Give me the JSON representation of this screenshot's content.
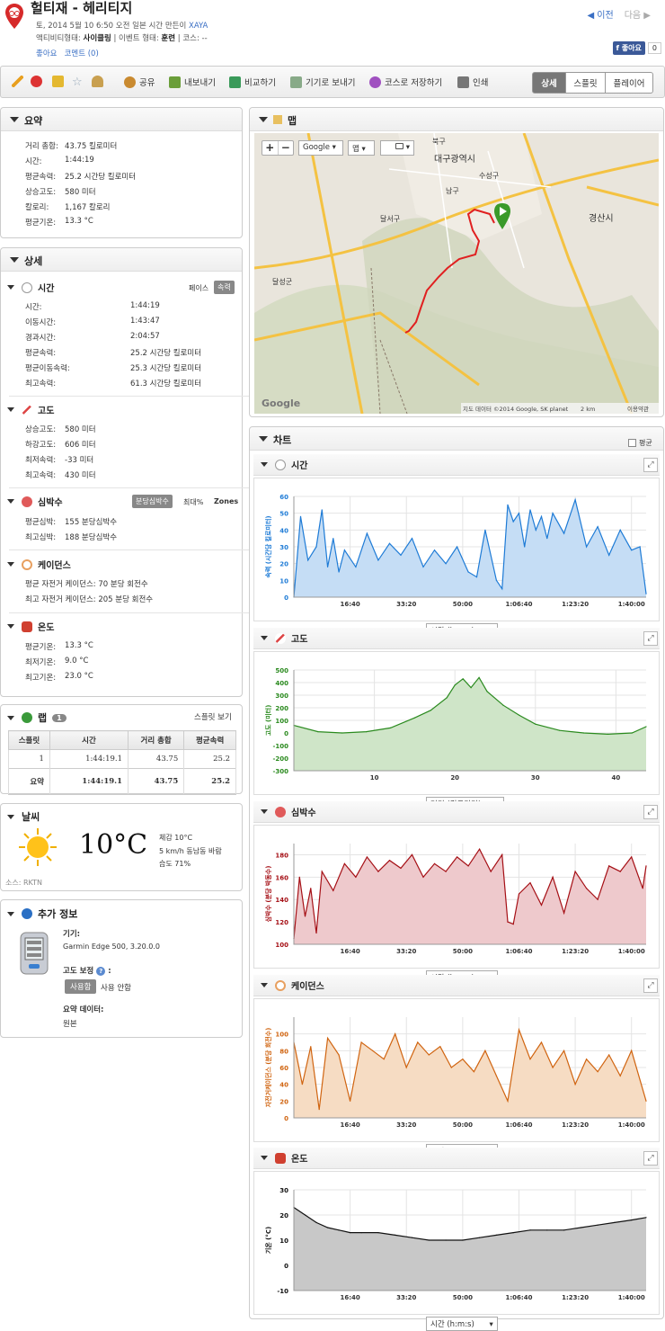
{
  "header": {
    "title": "헐티재 - 헤리티지",
    "meta_line": "토, 2014 5월 10 6:50 오전 일본 시간 만든이",
    "author": "XAYA",
    "activity_label": "액티비티형태:",
    "activity_value": "사이클링",
    "event_label": "| 이벤트 형태:",
    "event_value": "훈련",
    "course_label": "| 코스: --",
    "like": "좋아요",
    "comments": "코멘트 (0)",
    "prev": "◀ 이전",
    "next": "다음 ▶",
    "fb_like": "f 좋아요",
    "fb_count": "0"
  },
  "toolbar": {
    "share": "공유",
    "export": "내보내기",
    "compare": "비교하기",
    "send": "기기로 보내기",
    "save_course": "코스로 저장하기",
    "print": "인쇄",
    "tab_detail": "상세",
    "tab_splits": "스플릿",
    "tab_player": "플레이어"
  },
  "summary": {
    "title": "요약",
    "rows": [
      {
        "label": "거리 총합:",
        "value": "43.75 킬로미터"
      },
      {
        "label": "시간:",
        "value": "1:44:19"
      },
      {
        "label": "평균속력:",
        "value": "25.2 시간당 킬로미터"
      },
      {
        "label": "상승고도:",
        "value": "580 미터"
      },
      {
        "label": "칼로리:",
        "value": "1,167 칼로리"
      },
      {
        "label": "평균기온:",
        "value": "13.3 °C"
      }
    ]
  },
  "detail": {
    "title": "상세",
    "time": {
      "title": "시간",
      "pace": "페이스",
      "speed": "속력",
      "rows": [
        {
          "label": "시간:",
          "value": "1:44:19"
        },
        {
          "label": "이동시간:",
          "value": "1:43:47"
        },
        {
          "label": "경과시간:",
          "value": "2:04:57"
        },
        {
          "label": "평균속력:",
          "value": "25.2 시간당 킬로미터"
        },
        {
          "label": "평균이동속력:",
          "value": "25.3 시간당 킬로미터"
        },
        {
          "label": "최고속력:",
          "value": "61.3 시간당 킬로미터"
        }
      ]
    },
    "elevation": {
      "title": "고도",
      "rows": [
        {
          "label": "상승고도:",
          "value": "580 미터"
        },
        {
          "label": "하강고도:",
          "value": "606 미터"
        },
        {
          "label": "최저속력:",
          "value": "-33 미터"
        },
        {
          "label": "최고속력:",
          "value": "430 미터"
        }
      ]
    },
    "hr": {
      "title": "심박수",
      "bpm": "분당심박수",
      "max": "최대%",
      "zones": "Zones",
      "rows": [
        {
          "label": "평균심박:",
          "value": "155 분당심박수"
        },
        {
          "label": "최고심박:",
          "value": "188 분당심박수"
        }
      ]
    },
    "cadence": {
      "title": "케이던스",
      "rows": [
        {
          "text": "평균 자전거 케이던스: 70 분당 회전수"
        },
        {
          "text": "최고 자전거 케이던스: 205 분당 회전수"
        }
      ]
    },
    "temp": {
      "title": "온도",
      "rows": [
        {
          "label": "평균기온:",
          "value": "13.3 °C"
        },
        {
          "label": "최저기온:",
          "value": "9.0 °C"
        },
        {
          "label": "최고기온:",
          "value": "23.0 °C"
        }
      ]
    }
  },
  "laps": {
    "title": "랩",
    "count": "1",
    "split_view": "스플릿 보기",
    "headers": [
      "스플릿",
      "시간",
      "거리 총합",
      "평균속력"
    ],
    "rows": [
      [
        "1",
        "1:44:19.1",
        "43.75",
        "25.2"
      ]
    ],
    "summary": [
      "요약",
      "1:44:19.1",
      "43.75",
      "25.2"
    ]
  },
  "weather": {
    "title": "날씨",
    "temp": "10°C",
    "feels": "체감 10°C",
    "wind": "5 km/h 동남동 바람",
    "humidity": "습도 71%",
    "source": "소스: RKTN"
  },
  "extra": {
    "title": "추가 정보",
    "device_label": "기기:",
    "device": "Garmin Edge 500, 3.20.0.0",
    "elev_corr": "고도 보정",
    "elev_corr_suffix": ":",
    "on": "사용함",
    "off": "사용 안함",
    "summary_data_label": "요약 데이터:",
    "summary_data": "원본"
  },
  "map": {
    "title": "맵",
    "google": "Google ▾",
    "map": "맵 ▾",
    "layers": "▾",
    "city": "대구광역시",
    "gyeongsan": "경산시",
    "namgu": "남구",
    "dalseogu": "달서구",
    "suseonggu": "수성구",
    "bukgu": "북구",
    "dalseonggun": "달성군",
    "copyright": "지도 데이터 ©2014 Google, SK planet",
    "scale": "2 km",
    "terms": "이용약관",
    "logo": "Google"
  },
  "charts": {
    "title": "차트",
    "avg": "평균",
    "time_title": "시간",
    "elev_title": "고도",
    "hr_title": "심박수",
    "cad_title": "케이던스",
    "temp_title": "온도",
    "x_time": "시간 (h:m:s)",
    "x_dist": "거리 (킬로미터)"
  },
  "chart_data": [
    {
      "type": "area",
      "title": "시간",
      "ylabel": "속력 (시간당 킬로미터)",
      "xlabel": "시간 (h:m:s)",
      "xticks": [
        "16:40",
        "33:20",
        "50:00",
        "1:06:40",
        "1:23:20",
        "1:40:00"
      ],
      "xtick_seconds": [
        1000,
        2000,
        3000,
        4000,
        5000,
        6000
      ],
      "xlim": [
        0,
        6260
      ],
      "ylim": [
        0,
        60
      ],
      "yticks": [
        0,
        10,
        20,
        30,
        40,
        50,
        60
      ],
      "color": "#1e7bd6",
      "x": [
        0,
        120,
        250,
        400,
        500,
        600,
        700,
        800,
        900,
        1100,
        1300,
        1500,
        1700,
        1900,
        2100,
        2300,
        2500,
        2700,
        2900,
        3100,
        3250,
        3400,
        3600,
        3700,
        3800,
        3900,
        4000,
        4100,
        4200,
        4300,
        4400,
        4500,
        4600,
        4800,
        5000,
        5200,
        5400,
        5600,
        5800,
        6000,
        6150,
        6260
      ],
      "y": [
        0,
        48,
        22,
        30,
        52,
        18,
        35,
        15,
        28,
        18,
        38,
        22,
        32,
        25,
        35,
        18,
        28,
        20,
        30,
        15,
        12,
        40,
        10,
        5,
        55,
        45,
        50,
        30,
        52,
        40,
        48,
        35,
        50,
        38,
        58,
        30,
        42,
        25,
        40,
        28,
        30,
        2
      ]
    },
    {
      "type": "area",
      "title": "고도",
      "ylabel": "고도 (미터)",
      "xlabel": "거리 (킬로미터)",
      "xticks": [
        "10",
        "20",
        "30",
        "40"
      ],
      "xlim": [
        0,
        43.75
      ],
      "ylim": [
        -300,
        500
      ],
      "yticks": [
        -300,
        -200,
        -100,
        0,
        100,
        200,
        300,
        400,
        500
      ],
      "color": "#2a8a1e",
      "x": [
        0,
        3,
        6,
        9,
        12,
        15,
        17,
        19,
        20,
        21,
        22,
        23,
        24,
        26,
        28,
        30,
        33,
        36,
        39,
        42,
        43.75
      ],
      "y": [
        60,
        10,
        0,
        10,
        40,
        120,
        180,
        280,
        380,
        430,
        360,
        440,
        330,
        220,
        140,
        70,
        20,
        0,
        -10,
        0,
        50
      ]
    },
    {
      "type": "area",
      "title": "심박수",
      "ylabel": "심박수 (분당 박동수)",
      "xlabel": "시간 (h:m:s)",
      "xticks": [
        "16:40",
        "33:20",
        "50:00",
        "1:06:40",
        "1:23:20",
        "1:40:00"
      ],
      "xtick_seconds": [
        1000,
        2000,
        3000,
        4000,
        5000,
        6000
      ],
      "xlim": [
        0,
        6260
      ],
      "ylim": [
        100,
        190
      ],
      "yticks": [
        100,
        120,
        140,
        160,
        180
      ],
      "color": "#a50f15",
      "x": [
        0,
        100,
        200,
        300,
        400,
        500,
        700,
        900,
        1100,
        1300,
        1500,
        1700,
        1900,
        2100,
        2300,
        2500,
        2700,
        2900,
        3100,
        3300,
        3500,
        3700,
        3800,
        3900,
        4000,
        4200,
        4400,
        4600,
        4800,
        5000,
        5200,
        5400,
        5600,
        5800,
        6000,
        6200,
        6260
      ],
      "y": [
        105,
        160,
        125,
        150,
        110,
        165,
        148,
        172,
        160,
        178,
        165,
        175,
        168,
        180,
        160,
        172,
        165,
        178,
        170,
        185,
        165,
        180,
        120,
        118,
        145,
        155,
        135,
        160,
        128,
        165,
        150,
        140,
        170,
        165,
        178,
        150,
        170
      ]
    },
    {
      "type": "area",
      "title": "케이던스",
      "ylabel": "자전거케이던스 (분당 회전수)",
      "xlabel": "시간 (h:m:s)",
      "xticks": [
        "16:40",
        "33:20",
        "50:00",
        "1:06:40",
        "1:23:20",
        "1:40:00"
      ],
      "xtick_seconds": [
        1000,
        2000,
        3000,
        4000,
        5000,
        6000
      ],
      "xlim": [
        0,
        6260
      ],
      "ylim": [
        0,
        120
      ],
      "yticks": [
        0,
        20,
        40,
        60,
        80,
        100
      ],
      "color": "#d06410",
      "x": [
        0,
        150,
        300,
        450,
        600,
        800,
        1000,
        1200,
        1400,
        1600,
        1800,
        2000,
        2200,
        2400,
        2600,
        2800,
        3000,
        3200,
        3400,
        3600,
        3800,
        4000,
        4200,
        4400,
        4600,
        4800,
        5000,
        5200,
        5400,
        5600,
        5800,
        6000,
        6260
      ],
      "y": [
        90,
        40,
        85,
        10,
        95,
        75,
        20,
        90,
        80,
        70,
        100,
        60,
        90,
        75,
        85,
        60,
        70,
        55,
        80,
        50,
        20,
        105,
        70,
        90,
        60,
        80,
        40,
        70,
        55,
        75,
        50,
        80,
        20
      ]
    },
    {
      "type": "area",
      "title": "온도",
      "ylabel": "기온 (°C)",
      "xlabel": "시간 (h:m:s)",
      "xticks": [
        "16:40",
        "33:20",
        "50:00",
        "1:06:40",
        "1:23:20",
        "1:40:00"
      ],
      "xtick_seconds": [
        1000,
        2000,
        3000,
        4000,
        5000,
        6000
      ],
      "xlim": [
        0,
        6260
      ],
      "ylim": [
        -10,
        30
      ],
      "yticks": [
        -10,
        0,
        10,
        20,
        30
      ],
      "color": "#111111",
      "x": [
        0,
        200,
        400,
        600,
        800,
        1000,
        1200,
        1500,
        1800,
        2100,
        2400,
        2700,
        3000,
        3300,
        3600,
        3900,
        4200,
        4500,
        4800,
        5100,
        5400,
        5700,
        6000,
        6260
      ],
      "y": [
        23,
        20,
        17,
        15,
        14,
        13,
        13,
        13,
        12,
        11,
        10,
        10,
        10,
        11,
        12,
        13,
        14,
        14,
        14,
        15,
        16,
        17,
        18,
        19
      ]
    }
  ]
}
